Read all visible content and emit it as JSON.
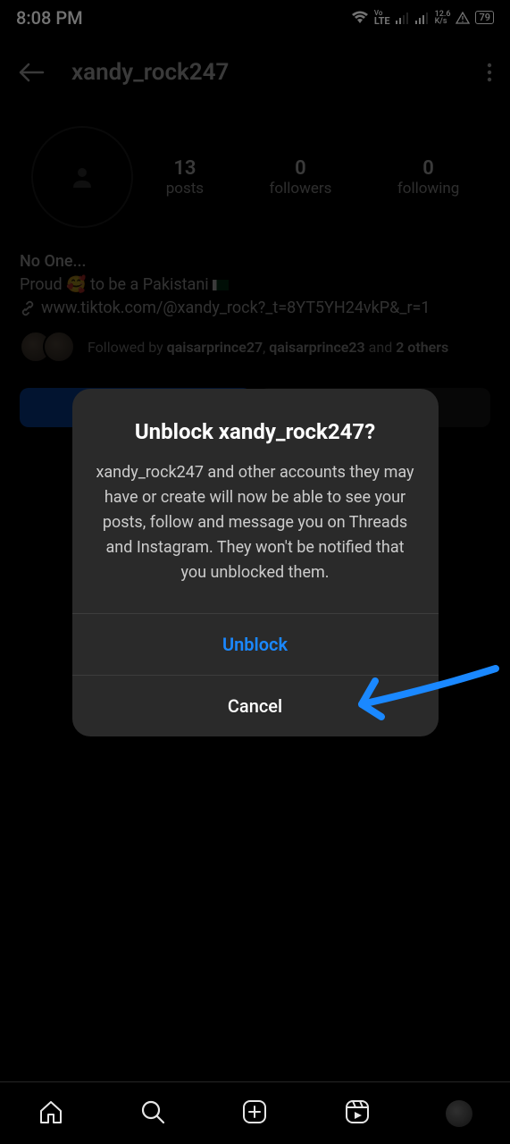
{
  "status": {
    "time": "8:08 PM",
    "lte_top": "Vo",
    "lte_bottom": "LTE",
    "rate_num": "12.6",
    "rate_unit": "K/s",
    "battery": "79"
  },
  "header": {
    "username": "xandy_rock247"
  },
  "stats": {
    "posts_count": "13",
    "posts_label": "posts",
    "followers_count": "0",
    "followers_label": "followers",
    "following_count": "0",
    "following_label": "following"
  },
  "bio": {
    "name": "No One...",
    "line1_prefix": "Proud ",
    "line1_suffix": " to be a Pakistani ",
    "link": "www.tiktok.com/@xandy_rock?_t=8YT5YH24vkP&_r=1"
  },
  "followed_by": {
    "prefix": "Followed by ",
    "user1": "qaisarprince27",
    "sep1": ", ",
    "user2": "qaisarprince23",
    "sep2": " and ",
    "others": "2 others"
  },
  "dialog": {
    "title": "Unblock xandy_rock247?",
    "body": "xandy_rock247 and other accounts they may have or create will now be able to see your posts, follow and message you on Threads and Instagram. They won't be notified that you unblocked them.",
    "unblock": "Unblock",
    "cancel": "Cancel"
  }
}
